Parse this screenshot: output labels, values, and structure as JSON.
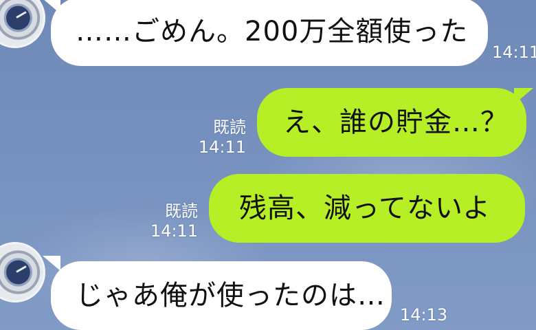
{
  "messages": [
    {
      "text": "……ごめん。200万全額使った",
      "time": "14:11"
    },
    {
      "text": "え、誰の貯金…？",
      "read": "既読",
      "time": "14:11"
    },
    {
      "text": "残高、減ってないよ",
      "read": "既読",
      "time": "14:11"
    },
    {
      "text": "じゃあ俺が使ったのは…",
      "time": "14:13"
    }
  ]
}
